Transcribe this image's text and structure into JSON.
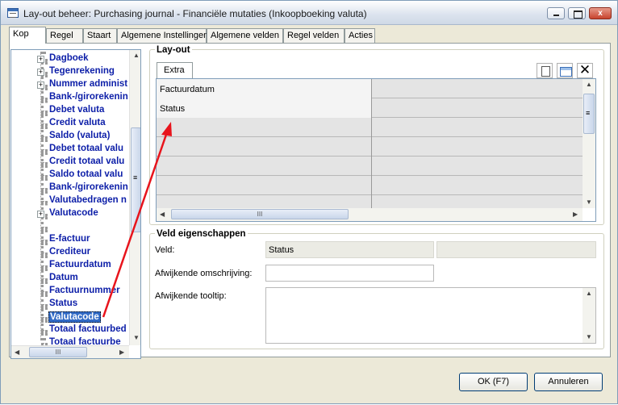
{
  "window": {
    "title": "Lay-out beheer: Purchasing journal - Financiële mutaties (Inkoopboeking valuta)",
    "close_glyph": "x",
    "colors": {
      "accent": "#316ac5",
      "tree_text": "#0c1ea8",
      "annotation_arrow": "#e8141c"
    }
  },
  "tabs": [
    "Kop",
    "Regel",
    "Staart",
    "Algemene Instellingen",
    "Algemene velden",
    "Regel velden",
    "Acties"
  ],
  "active_tab": "Kop",
  "tree": {
    "items": [
      {
        "label": "Dagboek",
        "expandable": true
      },
      {
        "label": "Tegenrekening",
        "expandable": true
      },
      {
        "label": "Nummer administ",
        "expandable": true
      },
      {
        "label": "Bank-/girorekenin",
        "expandable": false
      },
      {
        "label": "Debet valuta",
        "expandable": false
      },
      {
        "label": "Credit valuta",
        "expandable": false
      },
      {
        "label": "Saldo (valuta)",
        "expandable": false
      },
      {
        "label": "Debet totaal valu",
        "expandable": false
      },
      {
        "label": "Credit totaal valu",
        "expandable": false
      },
      {
        "label": "Saldo totaal valu",
        "expandable": false
      },
      {
        "label": "Bank-/girorekenin",
        "expandable": false
      },
      {
        "label": "Valutabedragen n",
        "expandable": false
      },
      {
        "label": "Valutacode",
        "expandable": true
      },
      {
        "label": "",
        "expandable": false
      },
      {
        "label": "E-factuur",
        "expandable": false
      },
      {
        "label": "Crediteur",
        "expandable": false
      },
      {
        "label": "Factuurdatum",
        "expandable": false
      },
      {
        "label": "Datum",
        "expandable": false
      },
      {
        "label": "Factuurnummer",
        "expandable": false
      },
      {
        "label": "Status",
        "expandable": false
      },
      {
        "label": "Valutacode",
        "expandable": false,
        "selected": true
      },
      {
        "label": "Totaal factuurbed",
        "expandable": false
      },
      {
        "label": "Totaal factuurbe",
        "expandable": false
      }
    ],
    "scroll_thumb_glyph": "≡",
    "hscroll_thumb_glyph": "III"
  },
  "layout": {
    "title": "Lay-out",
    "subtab": "Extra",
    "rows": [
      "Factuurdatum",
      "Status",
      "",
      "",
      "",
      "",
      ""
    ],
    "toolbar": {
      "new_icon": "new-document-icon",
      "edit_icon": "edit-table-icon",
      "delete_glyph": "✕"
    },
    "hscroll_thumb_glyph": "III",
    "vscroll_thumb_glyph": "≡"
  },
  "veld": {
    "title": "Veld eigenschappen",
    "veld_label": "Veld:",
    "veld_value": "Status",
    "veld_extra_value": "",
    "omschrijving_label": "Afwijkende omschrijving:",
    "omschrijving_value": "",
    "tooltip_label": "Afwijkende tooltip:",
    "tooltip_value": ""
  },
  "buttons": {
    "ok": "OK (F7)",
    "cancel": "Annuleren"
  }
}
